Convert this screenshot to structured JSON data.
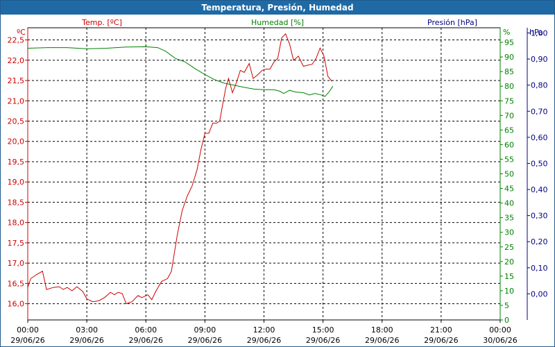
{
  "window": {
    "title": "Temperatura, Presión, Humedad"
  },
  "colors": {
    "temperature": "#cc0000",
    "humidity": "#008000",
    "pressure": "#000080",
    "grid": "#000000",
    "title_bar": "#1f6aa5"
  },
  "chart_data": {
    "type": "line",
    "title": "Temperatura, Presión, Humedad",
    "grid": true,
    "x_axis": {
      "range": [
        "29/06/26 00:00",
        "30/06/26 00:00"
      ],
      "ticks": [
        {
          "time": "00:00",
          "date": "29/06/26"
        },
        {
          "time": "03:00",
          "date": "29/06/26"
        },
        {
          "time": "06:00",
          "date": "29/06/26"
        },
        {
          "time": "09:00",
          "date": "29/06/26"
        },
        {
          "time": "12:00",
          "date": "29/06/26"
        },
        {
          "time": "15:00",
          "date": "29/06/26"
        },
        {
          "time": "18:00",
          "date": "29/06/26"
        },
        {
          "time": "21:00",
          "date": "29/06/26"
        },
        {
          "time": "00:00",
          "date": "30/06/26"
        }
      ]
    },
    "axes": {
      "temperature": {
        "label": "Temp. [ºC]",
        "unit": "ºC",
        "range": [
          15.6,
          22.8
        ],
        "ticks": [
          "22,5",
          "22,0",
          "21,5",
          "21,0",
          "20,5",
          "20,0",
          "19,5",
          "19,0",
          "18,5",
          "18,0",
          "17,5",
          "17,0",
          "16,5",
          "16,0"
        ],
        "tick_values": [
          22.5,
          22.0,
          21.5,
          21.0,
          20.5,
          20.0,
          19.5,
          19.0,
          18.5,
          18.0,
          17.5,
          17.0,
          16.5,
          16.0
        ]
      },
      "humidity": {
        "label": "Humedad [%]",
        "unit": "%",
        "range": [
          0,
          100
        ],
        "ticks": [
          "95",
          "90",
          "85",
          "80",
          "75",
          "70",
          "65",
          "60",
          "55",
          "50",
          "45",
          "40",
          "35",
          "30",
          "25",
          "20",
          "15",
          "10",
          "5",
          "0"
        ],
        "tick_values": [
          95,
          90,
          85,
          80,
          75,
          70,
          65,
          60,
          55,
          50,
          45,
          40,
          35,
          30,
          25,
          20,
          15,
          10,
          5,
          0
        ]
      },
      "pressure": {
        "label": "Presión [hPa]",
        "unit": "hPa",
        "range": [
          -0.1,
          1.02
        ],
        "ticks": [
          "1,00",
          "0,90",
          "0,80",
          "0,70",
          "0,60",
          "0,50",
          "0,40",
          "0,30",
          "0,20",
          "0,10",
          "0,00"
        ],
        "tick_values": [
          1.0,
          0.9,
          0.8,
          0.7,
          0.6,
          0.5,
          0.4,
          0.3,
          0.2,
          0.1,
          0.0
        ]
      }
    },
    "series": [
      {
        "name": "Temp. [ºC]",
        "axis": "temperature",
        "points": [
          [
            0.0,
            16.4
          ],
          [
            0.15,
            16.62
          ],
          [
            0.45,
            16.72
          ],
          [
            0.75,
            16.8
          ],
          [
            0.95,
            16.35
          ],
          [
            1.3,
            16.4
          ],
          [
            1.6,
            16.42
          ],
          [
            1.8,
            16.35
          ],
          [
            2.0,
            16.4
          ],
          [
            2.25,
            16.32
          ],
          [
            2.5,
            16.42
          ],
          [
            2.8,
            16.3
          ],
          [
            3.0,
            16.12
          ],
          [
            3.3,
            16.05
          ],
          [
            3.6,
            16.07
          ],
          [
            3.9,
            16.15
          ],
          [
            4.2,
            16.28
          ],
          [
            4.4,
            16.22
          ],
          [
            4.6,
            16.28
          ],
          [
            4.8,
            16.25
          ],
          [
            5.0,
            16.0
          ],
          [
            5.3,
            16.05
          ],
          [
            5.6,
            16.2
          ],
          [
            5.8,
            16.15
          ],
          [
            6.1,
            16.22
          ],
          [
            6.3,
            16.1
          ],
          [
            6.5,
            16.3
          ],
          [
            6.8,
            16.55
          ],
          [
            7.1,
            16.62
          ],
          [
            7.3,
            16.8
          ],
          [
            7.6,
            17.7
          ],
          [
            7.85,
            18.3
          ],
          [
            8.1,
            18.65
          ],
          [
            8.35,
            18.9
          ],
          [
            8.6,
            19.3
          ],
          [
            8.8,
            19.8
          ],
          [
            9.0,
            20.2
          ],
          [
            9.2,
            20.2
          ],
          [
            9.4,
            20.45
          ],
          [
            9.6,
            20.45
          ],
          [
            9.75,
            20.5
          ],
          [
            9.9,
            20.9
          ],
          [
            10.05,
            21.3
          ],
          [
            10.2,
            21.55
          ],
          [
            10.4,
            21.2
          ],
          [
            10.6,
            21.45
          ],
          [
            10.8,
            21.75
          ],
          [
            11.0,
            21.7
          ],
          [
            11.25,
            21.92
          ],
          [
            11.45,
            21.55
          ],
          [
            11.7,
            21.65
          ],
          [
            11.9,
            21.75
          ],
          [
            12.1,
            21.78
          ],
          [
            12.3,
            21.78
          ],
          [
            12.5,
            21.95
          ],
          [
            12.7,
            22.05
          ],
          [
            12.9,
            22.55
          ],
          [
            13.1,
            22.65
          ],
          [
            13.3,
            22.4
          ],
          [
            13.5,
            22.0
          ],
          [
            13.75,
            22.1
          ],
          [
            14.0,
            21.85
          ],
          [
            14.25,
            21.88
          ],
          [
            14.45,
            21.9
          ],
          [
            14.65,
            22.05
          ],
          [
            14.85,
            22.3
          ],
          [
            15.05,
            22.1
          ],
          [
            15.25,
            21.6
          ],
          [
            15.45,
            21.48
          ]
        ]
      },
      {
        "name": "Humedad [%]",
        "axis": "humidity",
        "points": [
          [
            0.0,
            93.0
          ],
          [
            1.0,
            93.2
          ],
          [
            2.0,
            93.2
          ],
          [
            3.0,
            92.8
          ],
          [
            4.0,
            93.0
          ],
          [
            5.0,
            93.4
          ],
          [
            6.0,
            93.5
          ],
          [
            6.6,
            93.2
          ],
          [
            7.0,
            92.0
          ],
          [
            7.5,
            89.5
          ],
          [
            8.0,
            88.3
          ],
          [
            8.5,
            86.0
          ],
          [
            9.0,
            84.0
          ],
          [
            9.5,
            82.2
          ],
          [
            10.0,
            81.0
          ],
          [
            10.5,
            80.3
          ],
          [
            11.0,
            79.6
          ],
          [
            11.5,
            79.0
          ],
          [
            12.0,
            78.8
          ],
          [
            12.5,
            78.8
          ],
          [
            12.8,
            78.3
          ],
          [
            13.0,
            77.5
          ],
          [
            13.3,
            78.6
          ],
          [
            13.6,
            78.0
          ],
          [
            14.0,
            77.8
          ],
          [
            14.3,
            77.0
          ],
          [
            14.6,
            77.5
          ],
          [
            14.9,
            77.0
          ],
          [
            15.1,
            76.5
          ],
          [
            15.3,
            78.0
          ],
          [
            15.5,
            80.0
          ]
        ]
      },
      {
        "name": "Presión [hPa]",
        "axis": "pressure",
        "points": []
      }
    ]
  }
}
